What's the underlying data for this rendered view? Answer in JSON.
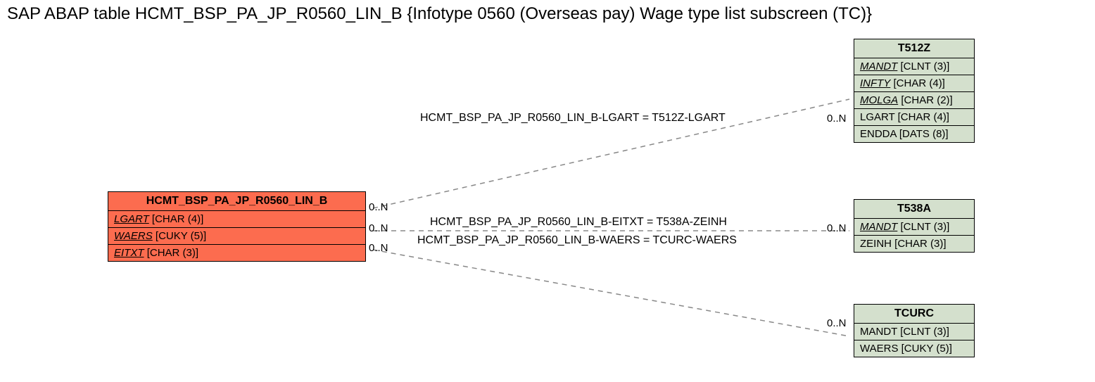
{
  "title": "SAP ABAP table HCMT_BSP_PA_JP_R0560_LIN_B {Infotype 0560 (Overseas pay) Wage type list subscreen (TC)}",
  "main_entity": {
    "name": "HCMT_BSP_PA_JP_R0560_LIN_B",
    "fields": [
      {
        "label": "LGART",
        "type": "[CHAR (4)]"
      },
      {
        "label": "WAERS",
        "type": "[CUKY (5)]"
      },
      {
        "label": "EITXT",
        "type": "[CHAR (3)]"
      }
    ]
  },
  "relations": [
    {
      "target": "T512Z",
      "label": "HCMT_BSP_PA_JP_R0560_LIN_B-LGART = T512Z-LGART",
      "left_card": "0..N",
      "right_card": "0..N",
      "fields": [
        {
          "label": "MANDT",
          "type": "[CLNT (3)]",
          "fk": true
        },
        {
          "label": "INFTY",
          "type": "[CHAR (4)]",
          "fk": true
        },
        {
          "label": "MOLGA",
          "type": "[CHAR (2)]",
          "fk": true
        },
        {
          "label": "LGART",
          "type": "[CHAR (4)]",
          "fk": false
        },
        {
          "label": "ENDDA",
          "type": "[DATS (8)]",
          "fk": false
        }
      ]
    },
    {
      "target": "T538A",
      "label": "HCMT_BSP_PA_JP_R0560_LIN_B-EITXT = T538A-ZEINH",
      "left_card": "0..N",
      "right_card": "0..N",
      "fields": [
        {
          "label": "MANDT",
          "type": "[CLNT (3)]",
          "fk": true
        },
        {
          "label": "ZEINH",
          "type": "[CHAR (3)]",
          "fk": false
        }
      ]
    },
    {
      "target": "TCURC",
      "label": "HCMT_BSP_PA_JP_R0560_LIN_B-WAERS = TCURC-WAERS",
      "left_card": "0..N",
      "right_card": "0..N",
      "fields": [
        {
          "label": "MANDT",
          "type": "[CLNT (3)]",
          "fk": false
        },
        {
          "label": "WAERS",
          "type": "[CUKY (5)]",
          "fk": false
        }
      ]
    }
  ]
}
